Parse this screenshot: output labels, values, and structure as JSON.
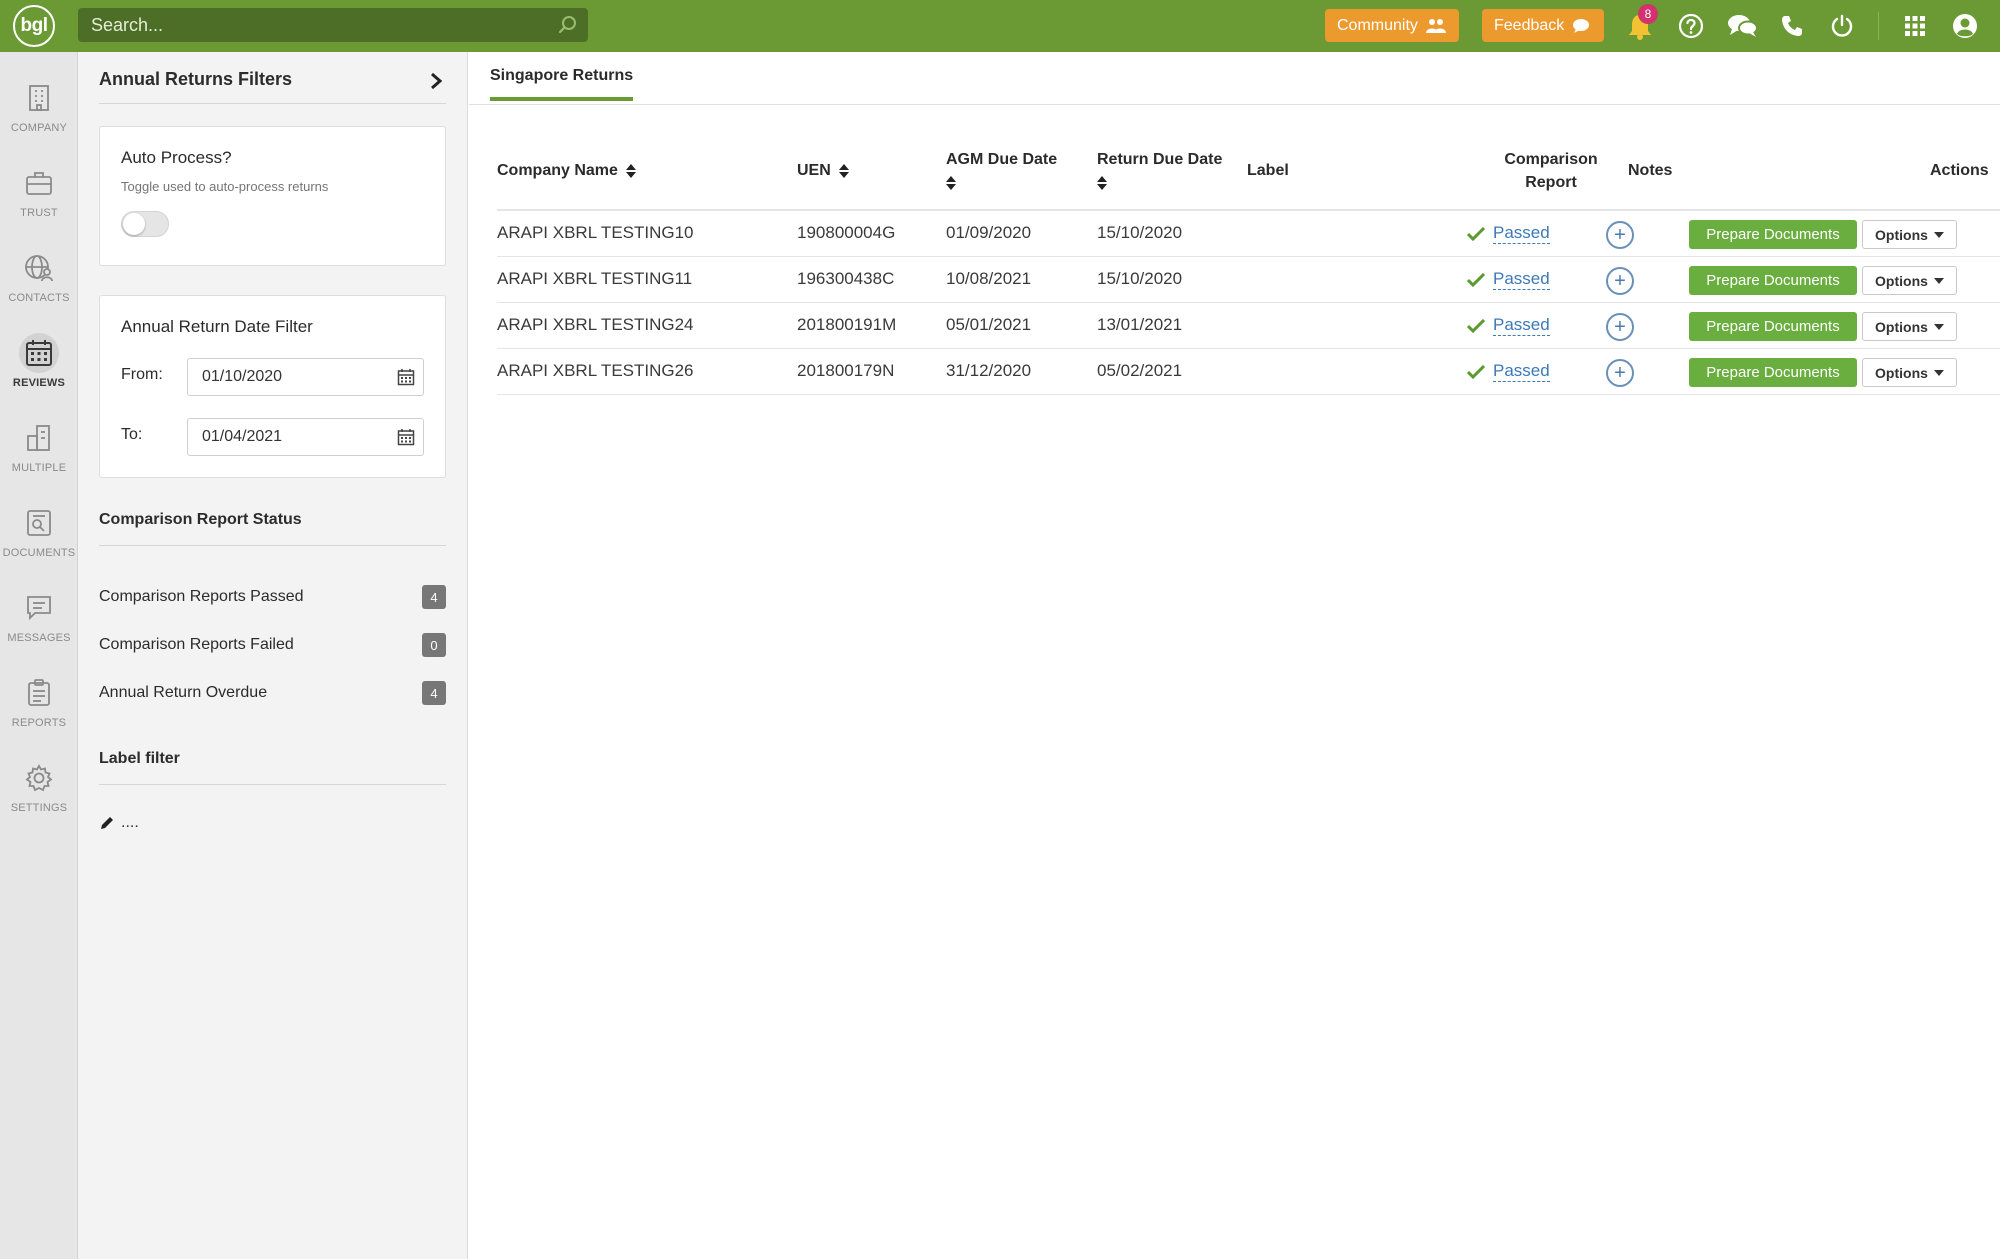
{
  "topbar": {
    "logo_text": "bgl",
    "search_placeholder": "Search...",
    "community_label": "Community",
    "feedback_label": "Feedback",
    "notification_count": "8",
    "colors": {
      "bar": "#6b9a34",
      "accent": "#ec9a2e",
      "badge": "#d2336e"
    }
  },
  "rail": {
    "items": [
      {
        "label": "COMPANY",
        "icon": "building-icon"
      },
      {
        "label": "TRUST",
        "icon": "briefcase-icon"
      },
      {
        "label": "CONTACTS",
        "icon": "globe-person-icon"
      },
      {
        "label": "REVIEWS",
        "icon": "calendar-icon",
        "active": true
      },
      {
        "label": "MULTIPLE",
        "icon": "multiple-buildings-icon"
      },
      {
        "label": "DOCUMENTS",
        "icon": "document-icon"
      },
      {
        "label": "MESSAGES",
        "icon": "message-icon"
      },
      {
        "label": "REPORTS",
        "icon": "clipboard-icon"
      },
      {
        "label": "SETTINGS",
        "icon": "gear-icon"
      }
    ]
  },
  "filters": {
    "title": "Annual Returns Filters",
    "auto_process": {
      "title": "Auto Process?",
      "subtitle": "Toggle used to auto-process returns",
      "enabled": false
    },
    "date_filter": {
      "title": "Annual Return Date Filter",
      "from_label": "From:",
      "from_value": "01/10/2020",
      "to_label": "To:",
      "to_value": "01/04/2021"
    },
    "status": {
      "title": "Comparison Report Status",
      "items": [
        {
          "label": "Comparison Reports Passed",
          "count": "4"
        },
        {
          "label": "Comparison Reports Failed",
          "count": "0"
        },
        {
          "label": "Annual Return Overdue",
          "count": "4"
        }
      ]
    },
    "label_filter": {
      "title": "Label filter",
      "value": "...."
    }
  },
  "main": {
    "tab": "Singapore Returns",
    "columns": {
      "company": "Company Name",
      "uen": "UEN",
      "agm": "AGM Due Date",
      "return_due": "Return Due Date",
      "label": "Label",
      "comparison_1": "Comparison",
      "comparison_2": "Report",
      "notes": "Notes",
      "actions": "Actions"
    },
    "rows": [
      {
        "company": "ARAPI XBRL TESTING10",
        "uen": "190800004G",
        "agm": "01/09/2020",
        "return_due": "15/10/2020",
        "label": "",
        "comparison": "Passed",
        "prepare": "Prepare Documents",
        "options": "Options"
      },
      {
        "company": "ARAPI XBRL TESTING11",
        "uen": "196300438C",
        "agm": "10/08/2021",
        "return_due": "15/10/2020",
        "label": "",
        "comparison": "Passed",
        "prepare": "Prepare Documents",
        "options": "Options"
      },
      {
        "company": "ARAPI XBRL TESTING24",
        "uen": "201800191M",
        "agm": "05/01/2021",
        "return_due": "13/01/2021",
        "label": "",
        "comparison": "Passed",
        "prepare": "Prepare Documents",
        "options": "Options"
      },
      {
        "company": "ARAPI XBRL TESTING26",
        "uen": "201800179N",
        "agm": "31/12/2020",
        "return_due": "05/02/2021",
        "label": "",
        "comparison": "Passed",
        "prepare": "Prepare Documents",
        "options": "Options"
      }
    ]
  }
}
